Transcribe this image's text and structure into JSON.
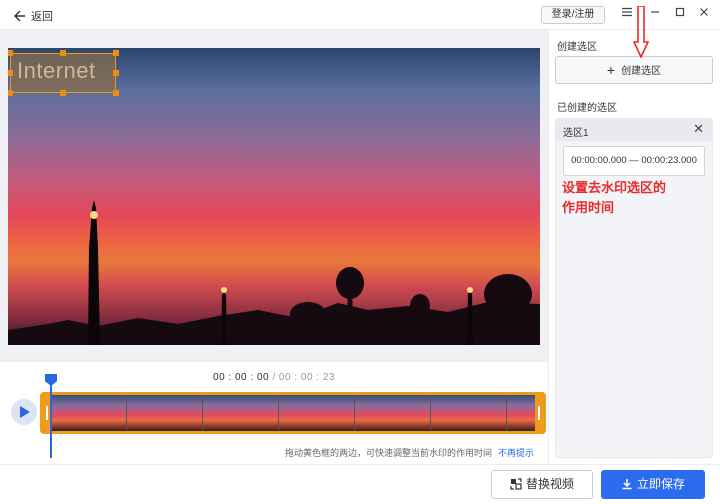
{
  "header": {
    "back_label": "返回",
    "login_label": "登录/注册",
    "menu_icon": "menu-icon",
    "minimize_icon": "minimize-icon",
    "maximize_icon": "maximize-icon",
    "close_icon": "close-icon"
  },
  "watermark": {
    "text": "Internet"
  },
  "timeline": {
    "current_time": "00 : 00 : 00",
    "separator": " / ",
    "total_time": "00 : 00 : 23",
    "hint": "拖动黄色框的两边，可快速调整当前水印的作用时间",
    "dismiss_label": "不再提示"
  },
  "panel": {
    "create_section_title": "创建选区",
    "create_button_label": "创建选区",
    "created_section_title": "已创建的选区",
    "regions": [
      {
        "name": "选区1",
        "range": "00:00:00.000 — 00:00:23.000"
      }
    ]
  },
  "annotation": {
    "text_line1": "设置去水印选区的",
    "text_line2": "作用时间"
  },
  "footer": {
    "replace_label": "替换视频",
    "save_label": "立即保存"
  },
  "colors": {
    "accent": "#2b6bf0",
    "handle": "#f29a1a",
    "annotation": "#e82a2a"
  }
}
